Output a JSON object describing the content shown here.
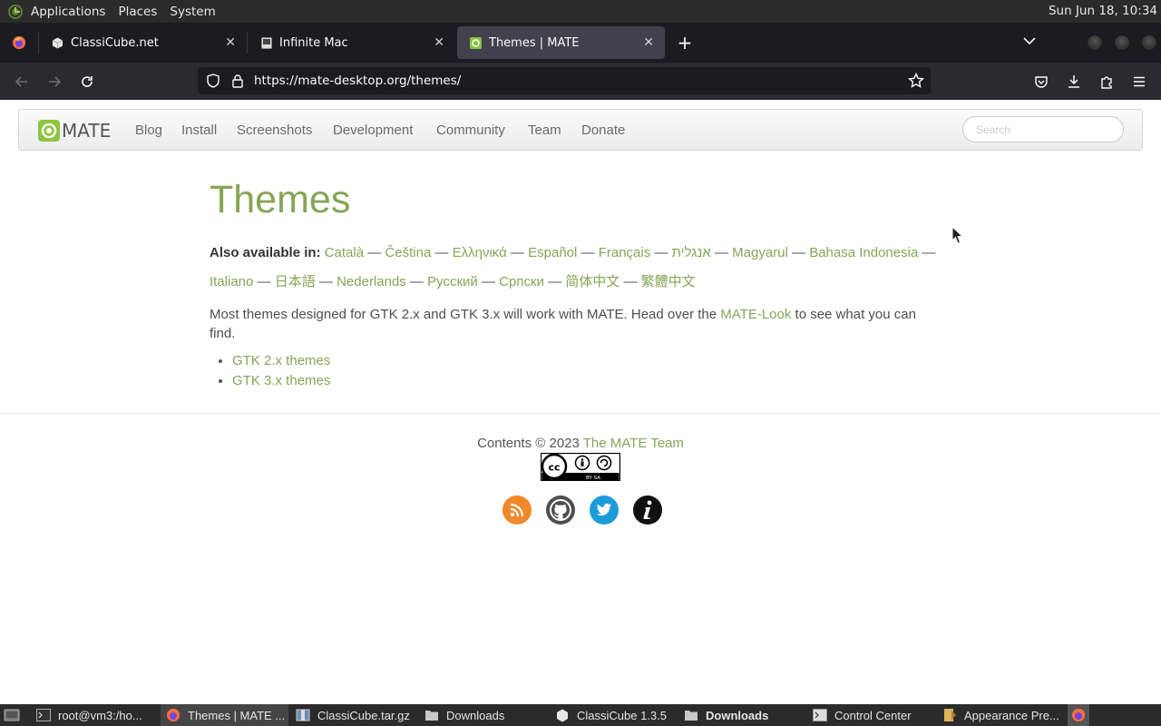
{
  "top_panel": {
    "menus": [
      "Applications",
      "Places",
      "System"
    ],
    "clock": "Sun Jun 18, 10:34"
  },
  "tabs": [
    {
      "title": "ClassiCube.net"
    },
    {
      "title": "Infinite Mac"
    },
    {
      "title": "Themes | MATE"
    }
  ],
  "navbar": {
    "url": "https://mate-desktop.org/themes/"
  },
  "site_nav": {
    "brand": "MATE",
    "links": [
      "Blog",
      "Install",
      "Screenshots",
      "Development",
      "Community",
      "Team",
      "Donate"
    ],
    "search_placeholder": "Search"
  },
  "page": {
    "title": "Themes",
    "also_available_label": "Also available in:",
    "languages": [
      "Català",
      "Čeština",
      "Ελληνικά",
      "Español",
      "Français",
      "אנגלית",
      "Magyarul",
      "Bahasa Indonesia",
      "Italiano",
      "日本語",
      "Nederlands",
      "Русский",
      "Српски",
      "简体中文",
      "繁體中文"
    ],
    "separator": "—",
    "intro_before": "Most themes designed for GTK 2.x and GTK 3.x will work with MATE. Head over the ",
    "intro_link": "MATE-Look",
    "intro_after": " to see what you can find.",
    "theme_links": [
      "GTK 2.x themes",
      "GTK 3.x themes"
    ]
  },
  "footer": {
    "contents_prefix": "Contents © 2023 ",
    "team_link": "The MATE Team",
    "license_badge": "BY SA",
    "social_icons": [
      "rss-icon",
      "github-icon",
      "twitter-icon",
      "info-icon"
    ]
  },
  "taskbar": {
    "items": [
      {
        "label": "root@vm3:/ho...",
        "icon": "terminal-icon"
      },
      {
        "label": "Themes | MATE ...",
        "icon": "firefox-icon"
      },
      {
        "label": "ClassiCube.tar.gz",
        "icon": "archive-icon"
      },
      {
        "label": "Downloads",
        "icon": "folder-icon"
      },
      {
        "label": "ClassiCube 1.3.5",
        "icon": "classicube-icon"
      },
      {
        "label": "Downloads",
        "icon": "folder-icon"
      },
      {
        "label": "Control Center",
        "icon": "control-center-icon"
      },
      {
        "label": "Appearance Pre...",
        "icon": "appearance-icon"
      }
    ]
  },
  "colors": {
    "accent_green": "#87a556",
    "panel_bg": "#2b2b2b",
    "tabbar_bg": "#1c1b22",
    "navbar_bg": "#2b2a33"
  }
}
